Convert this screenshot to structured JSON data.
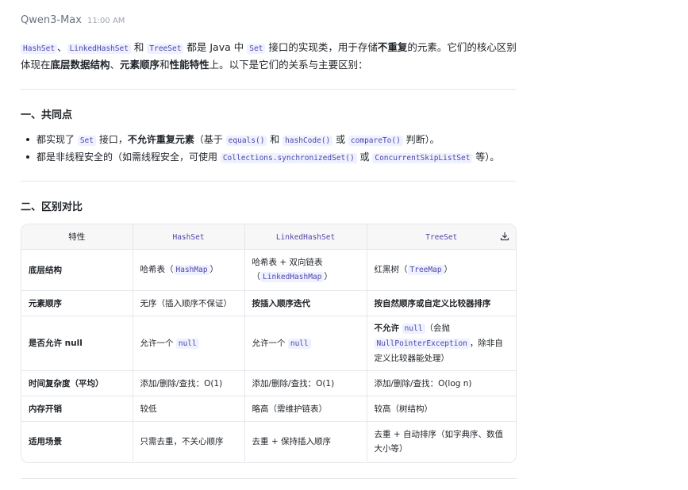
{
  "message": {
    "sender": "Qwen3-Max",
    "time": "11:00 AM"
  },
  "intro": {
    "code1": "HashSet",
    "sep1": "、",
    "code2": "LinkedHashSet",
    "and1": " 和 ",
    "code3": "TreeSet",
    "text1": " 都是 Java 中 ",
    "code4": "Set",
    "text2": " 接口的实现类，用于存储",
    "bold1": "不重复",
    "text3": "的元素。它们的核心区别体现在",
    "bold2": "底层数据结构",
    "text4": "、",
    "bold3": "元素顺序",
    "text5": "和",
    "bold4": "性能特性",
    "text6": "上。以下是它们的关系与主要区别："
  },
  "section1": {
    "title": "一、共同点",
    "bullet1": {
      "a": "都实现了 ",
      "code1": "Set",
      "b": " 接口，",
      "bold": "不允许重复元素",
      "c": "（基于 ",
      "code2": "equals()",
      "d": " 和 ",
      "code3": "hashCode()",
      "e": " 或 ",
      "code4": "compareTo()",
      "f": " 判断）。"
    },
    "bullet2": {
      "a": "都是非线程安全的（如需线程安全，可使用 ",
      "code1": "Collections.synchronizedSet()",
      "b": " 或 ",
      "code2": "ConcurrentSkipListSet",
      "c": " 等）。"
    }
  },
  "section2": {
    "title": "二、区别对比"
  },
  "table": {
    "headers": [
      "特性",
      "HashSet",
      "LinkedHashSet",
      "TreeSet"
    ],
    "download_icon": "download-icon",
    "rows": [
      {
        "feature": "底层结构",
        "hash": {
          "a": "哈希表（",
          "code": "HashMap",
          "b": "）"
        },
        "linked": {
          "a": "哈希表 + 双向链表（",
          "code": "LinkedHashMap",
          "b": "）"
        },
        "tree": {
          "a": "红黑树（",
          "code": "TreeMap",
          "b": "）"
        }
      },
      {
        "feature": "元素顺序",
        "hash": "无序（插入顺序不保证）",
        "linked": "按插入顺序迭代",
        "tree": "按自然顺序或自定义比较器排序"
      },
      {
        "feature": "是否允许 null",
        "hash": {
          "a": "允许一个 ",
          "code": "null"
        },
        "linked": {
          "a": "允许一个 ",
          "code": "null"
        },
        "tree": {
          "bold": "不允许 ",
          "code": "null",
          "a": "（会抛 ",
          "code2": "NullPointerException",
          "b": "，除非自定义比较器能处理）"
        }
      },
      {
        "feature": "时间复杂度（平均）",
        "hash": "添加/删除/查找：O(1)",
        "linked": "添加/删除/查找：O(1)",
        "tree": "添加/删除/查找：O(log n)"
      },
      {
        "feature": "内存开销",
        "hash": "较低",
        "linked": "略高（需维护链表）",
        "tree": "较高（树结构）"
      },
      {
        "feature": "适用场景",
        "hash": "只需去重，不关心顺序",
        "linked": "去重 + 保持插入顺序",
        "tree": "去重 + 自动排序（如字典序、数值大小等）"
      }
    ]
  }
}
